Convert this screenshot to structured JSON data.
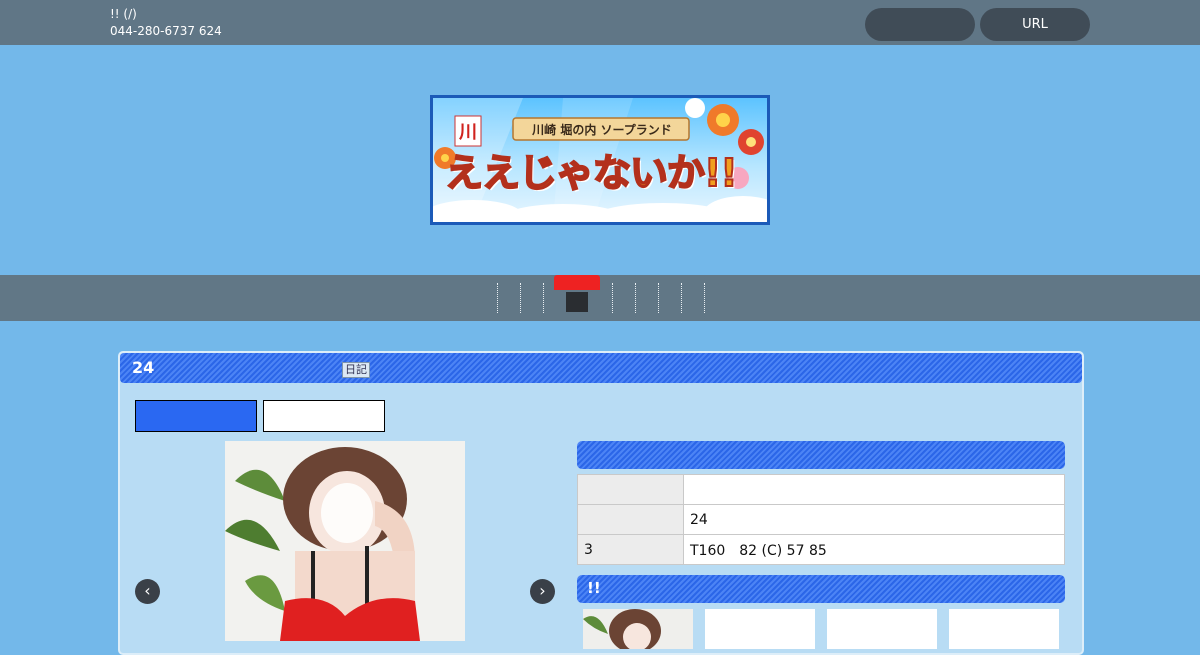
{
  "header": {
    "shop_title": "!! (/)",
    "phone": "044-280-6737 624",
    "buttons": [
      "",
      "URL"
    ]
  },
  "banner": {
    "tagline": "川崎 堀の内 ソープランド",
    "logo_text": "ええじゃないか!!",
    "mark": "川"
  },
  "nav": {
    "item_count": 9,
    "active_index": 3
  },
  "profile_panel": {
    "age": "24",
    "diary_badge": "日記",
    "tabs": [
      "",
      ""
    ],
    "table": [
      {
        "label": "",
        "value": ""
      },
      {
        "label": "",
        "value": "24"
      },
      {
        "label": "3",
        "value": "T160　82 (C)  57  85"
      }
    ],
    "new_section_title": "!!",
    "prev_arrow": "‹",
    "next_arrow": "›"
  },
  "colors": {
    "page_bg": "#73b8ea",
    "bar_bg": "#607686",
    "accent_blue": "#2a68f2",
    "nav_active": "#ee2222"
  }
}
